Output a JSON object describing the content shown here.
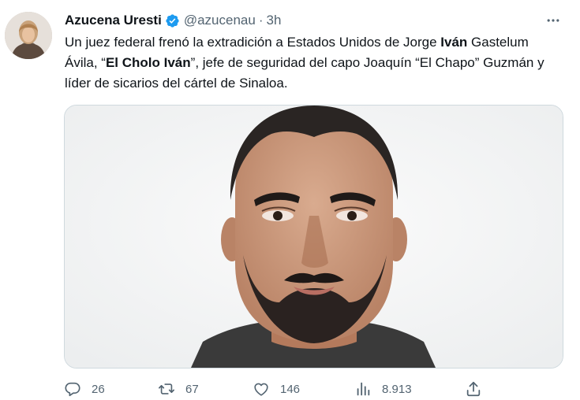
{
  "tweet": {
    "author": {
      "display_name": "Azucena Uresti",
      "handle": "@azucenau",
      "verified": true
    },
    "separator": "·",
    "time": "3h",
    "text_parts": [
      "Un juez federal frenó la extradición a Estados Unidos de Jorge ",
      "Iván",
      " Gastelum Ávila, “",
      "El Cholo Iván",
      "”, jefe de seguridad del capo Joaquín “El Chapo” Guzmán y líder de sicarios del cártel de Sinaloa."
    ],
    "media": {
      "icon": "photo"
    },
    "actions": {
      "replies": "26",
      "retweets": "67",
      "likes": "146",
      "views": "8.913"
    }
  },
  "icons": {
    "verified": "verified-badge-icon",
    "more": "more-horizontal-icon",
    "reply": "reply-bubble-icon",
    "retweet": "retweet-icon",
    "like": "heart-icon",
    "views": "views-bar-chart-icon",
    "share": "share-upload-icon"
  },
  "colors": {
    "verified": "#1d9bf0",
    "text": "#0f1419",
    "secondary": "#536471",
    "border": "#cfd9de"
  }
}
